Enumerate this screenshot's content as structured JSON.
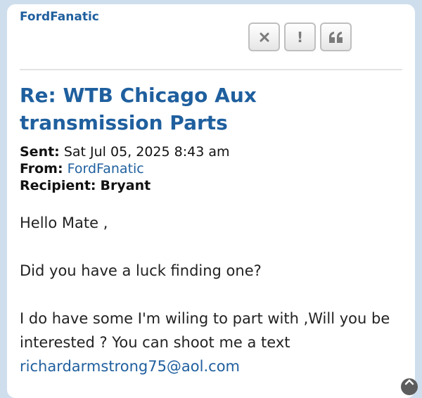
{
  "post": {
    "author": "FordFanatic",
    "title": "Re: WTB Chicago Aux transmission Parts",
    "sent_label": "Sent:",
    "sent_value": "Sat Jul 05, 2025 8:43 am",
    "from_label": "From:",
    "from_value": "FordFanatic",
    "recipient_label": "Recipient:",
    "recipient_value": "Bryant"
  },
  "actions": [
    {
      "icon": "close-icon"
    },
    {
      "icon": "report-icon",
      "glyph": "!"
    },
    {
      "icon": "quote-icon"
    }
  ],
  "message": {
    "line1": "Hello Mate ,",
    "line2": "Did you have a luck finding one?",
    "line3": "I do have some I'm wiling to part with ,Will you be interested ? You can shoot me a text",
    "email": "richardarmstrong75@aol.com"
  },
  "colors": {
    "accent": "#1f5f9e",
    "background": "#cfdeed"
  }
}
